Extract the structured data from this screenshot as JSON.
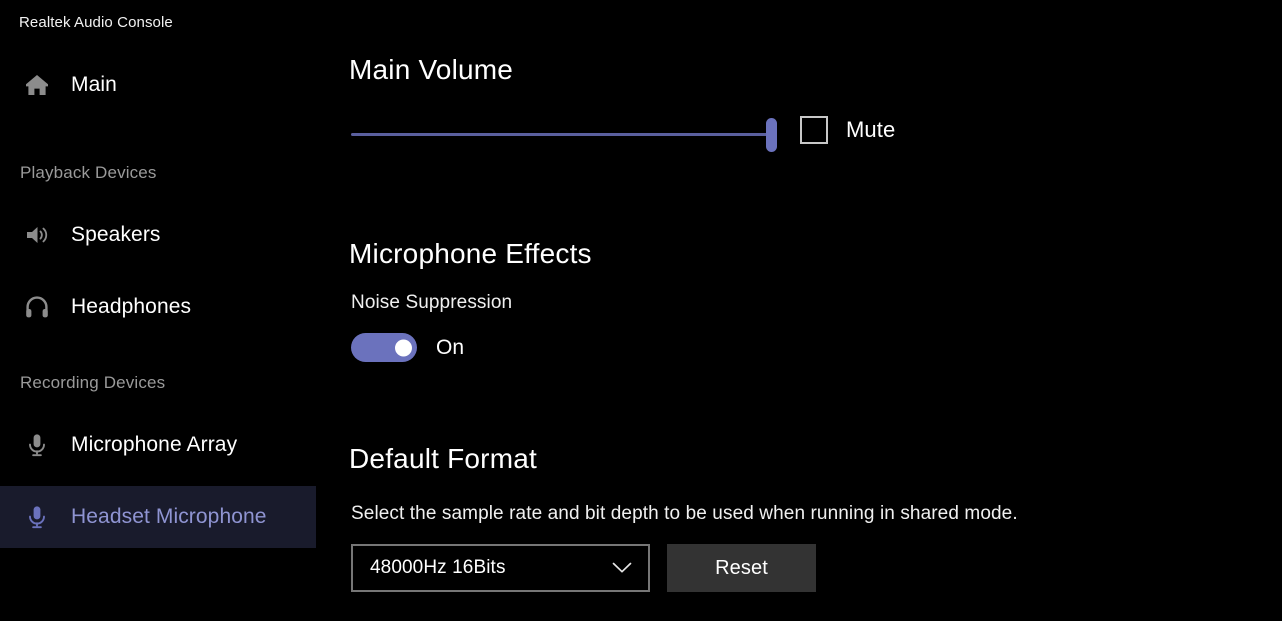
{
  "app": {
    "title": "Realtek Audio Console",
    "accent_color": "#6b72bd",
    "background_color": "#000000",
    "selected_row_color": "#191b2c",
    "selected_text_color": "#8f94d2"
  },
  "sidebar": {
    "items": [
      {
        "label": "Main",
        "icon": "home-icon",
        "selected": false
      },
      {
        "label": "Speakers",
        "icon": "speaker-icon",
        "selected": false
      },
      {
        "label": "Headphones",
        "icon": "headphones-icon",
        "selected": false
      },
      {
        "label": "Microphone Array",
        "icon": "microphone-icon",
        "selected": false
      },
      {
        "label": "Headset Microphone",
        "icon": "microphone-icon",
        "selected": true
      }
    ],
    "groups": [
      {
        "label": "Playback Devices"
      },
      {
        "label": "Recording Devices"
      }
    ]
  },
  "main_volume": {
    "title": "Main Volume",
    "value": 100,
    "min": 0,
    "max": 100,
    "mute": {
      "label": "Mute",
      "checked": false
    }
  },
  "microphone_effects": {
    "title": "Microphone Effects",
    "noise_suppression": {
      "label": "Noise Suppression",
      "state_label": "On",
      "enabled": true
    }
  },
  "default_format": {
    "title": "Default Format",
    "description": "Select the sample rate and bit depth to be used when running in shared mode.",
    "dropdown": {
      "selected": "48000Hz 16Bits",
      "chevron_icon": "chevron-down-icon"
    },
    "reset_label": "Reset"
  }
}
